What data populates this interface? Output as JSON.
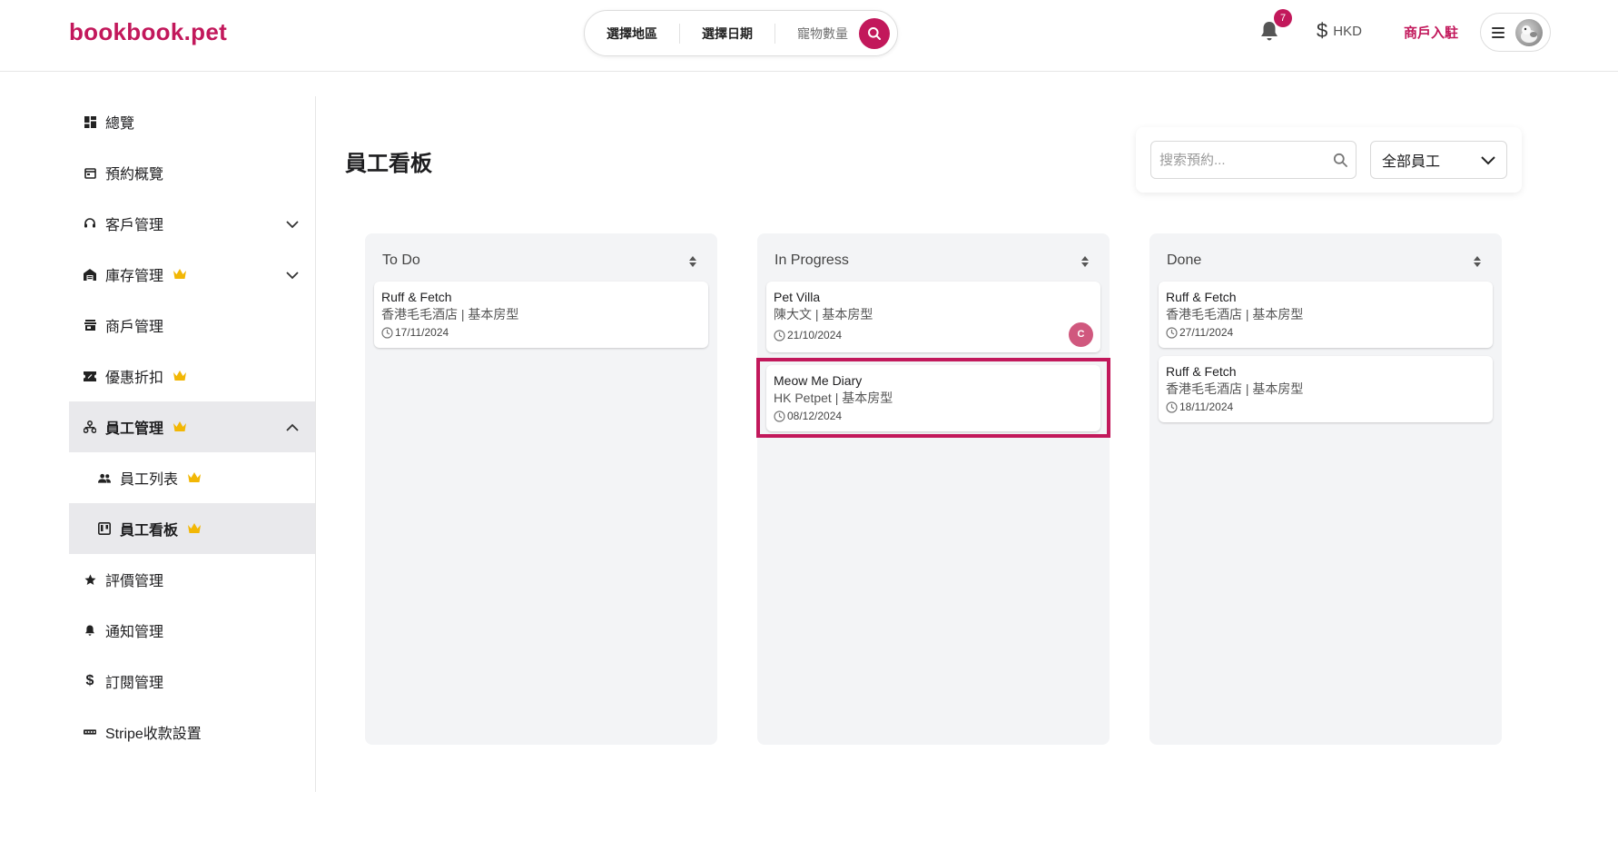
{
  "header": {
    "logo": "bookbook.pet",
    "search": {
      "region": "選擇地區",
      "date": "選擇日期",
      "pets": "寵物數量"
    },
    "notifications_count": "7",
    "currency": "HKD",
    "merchant_link": "商戶入駐"
  },
  "sidebar": {
    "items": [
      {
        "label": "總覽",
        "icon": "dashboard-icon"
      },
      {
        "label": "預約概覽",
        "icon": "calendar-icon"
      },
      {
        "label": "客戶管理",
        "icon": "headset-icon",
        "expandable": true
      },
      {
        "label": "庫存管理",
        "icon": "warehouse-icon",
        "premium": true,
        "expandable": true
      },
      {
        "label": "商戶管理",
        "icon": "store-icon"
      },
      {
        "label": "優惠折扣",
        "icon": "ticket-icon",
        "premium": true
      },
      {
        "label": "員工管理",
        "icon": "org-chart-icon",
        "premium": true,
        "expanded": true
      },
      {
        "label": "員工列表",
        "icon": "people-icon",
        "premium": true,
        "sub": true
      },
      {
        "label": "員工看板",
        "icon": "kanban-icon",
        "premium": true,
        "sub": true,
        "active": true
      },
      {
        "label": "評價管理",
        "icon": "star-icon"
      },
      {
        "label": "通知管理",
        "icon": "bell-icon"
      },
      {
        "label": "訂閱管理",
        "icon": "dollar-icon"
      },
      {
        "label": "Stripe收款設置",
        "icon": "stripe-icon"
      }
    ]
  },
  "main": {
    "title": "員工看板",
    "search_placeholder": "搜索預約...",
    "staff_filter": "全部員工"
  },
  "board": {
    "columns": [
      {
        "title": "To Do",
        "cards": [
          {
            "name": "Ruff & Fetch",
            "sub": "香港毛毛酒店 | 基本房型",
            "date": "17/11/2024"
          }
        ]
      },
      {
        "title": "In Progress",
        "cards": [
          {
            "name": "Pet Villa",
            "sub": "陳大文 | 基本房型",
            "date": "21/10/2024",
            "assignee": "C"
          },
          {
            "name": "Meow Me Diary",
            "sub": "HK Petpet | 基本房型",
            "date": "08/12/2024"
          }
        ]
      },
      {
        "title": "Done",
        "cards": [
          {
            "name": "Ruff & Fetch",
            "sub": "香港毛毛酒店 | 基本房型",
            "date": "27/11/2024"
          },
          {
            "name": "Ruff & Fetch",
            "sub": "香港毛毛酒店 | 基本房型",
            "date": "18/11/2024"
          }
        ]
      }
    ]
  },
  "colors": {
    "brand": "#c2185b",
    "crown": "#f2b705",
    "column_bg": "#f3f4f6",
    "active_nav_bg": "#e9e9ec"
  }
}
